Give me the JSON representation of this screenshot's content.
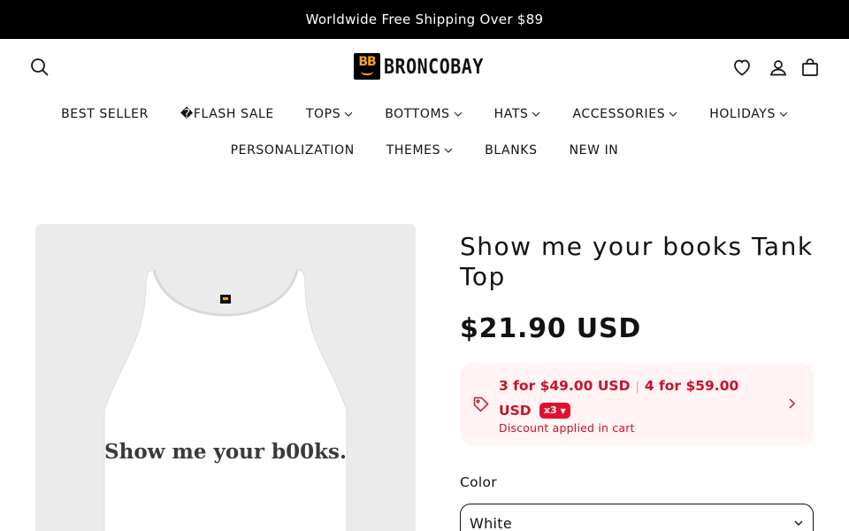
{
  "announcement": {
    "text": "Worldwide Free Shipping Over $89"
  },
  "header": {
    "logo_mark": "BB",
    "logo_text": "BRONCOBAY",
    "icons": [
      "search-icon",
      "heart-icon",
      "account-icon",
      "cart-icon"
    ]
  },
  "nav": {
    "row1": [
      {
        "label": "BEST SELLER",
        "has_dropdown": false
      },
      {
        "label": "�FLASH SALE",
        "has_dropdown": false
      },
      {
        "label": "TOPS",
        "has_dropdown": true
      },
      {
        "label": "BOTTOMS",
        "has_dropdown": true
      },
      {
        "label": "HATS",
        "has_dropdown": true
      },
      {
        "label": "ACCESSORIES",
        "has_dropdown": true
      },
      {
        "label": "HOLIDAYS",
        "has_dropdown": true
      }
    ],
    "row2": [
      {
        "label": "PERSONALIZATION",
        "has_dropdown": false
      },
      {
        "label": "THEMES",
        "has_dropdown": true
      },
      {
        "label": "BLANKS",
        "has_dropdown": false
      },
      {
        "label": "NEW IN",
        "has_dropdown": false
      }
    ]
  },
  "product": {
    "image_text": "Show me your b00ks.",
    "title": "Show me your books Tank Top",
    "price": "$21.90 USD",
    "discount": {
      "offer1": "3 for $49.00 USD",
      "offer2": "4 for $59.00",
      "offer2_cont": "USD",
      "badge": "x3",
      "note": "Discount applied in cart"
    },
    "color_label": "Color",
    "color_value": "White"
  },
  "colors": {
    "accent_red": "#c8102e",
    "discount_bg": "#fff4f3",
    "announcement_bg": "#000000"
  }
}
